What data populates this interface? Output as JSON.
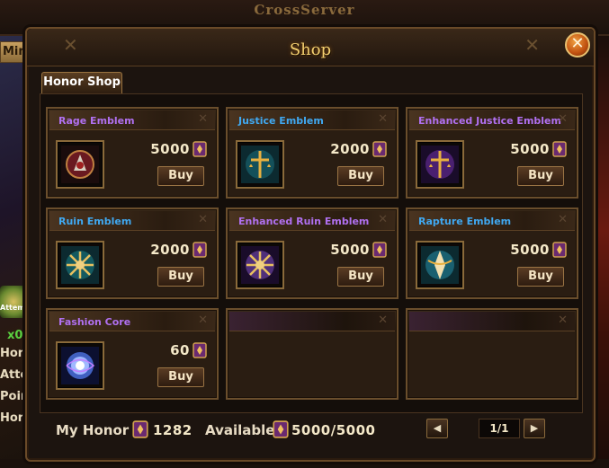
{
  "background": {
    "top_title": "CrossServer",
    "left_tab": "Mine",
    "left_counter": "x0",
    "left_words": [
      "Hon",
      "Atte",
      "Poin",
      "Hon"
    ],
    "left_badge_text": "Attemp"
  },
  "window": {
    "title": "Shop",
    "close_label": "✕"
  },
  "tab": {
    "label": "Honor Shop"
  },
  "items": [
    {
      "name": "Rage Emblem",
      "name_color": "#b070f0",
      "price": "5000",
      "buy_label": "Buy",
      "icon": "rage-emblem-icon"
    },
    {
      "name": "Justice Emblem",
      "name_color": "#40a8f0",
      "price": "2000",
      "buy_label": "Buy",
      "icon": "justice-emblem-icon"
    },
    {
      "name": "Enhanced Justice Emblem",
      "name_color": "#b070f0",
      "price": "5000",
      "buy_label": "Buy",
      "icon": "enhanced-justice-emblem-icon"
    },
    {
      "name": "Ruin Emblem",
      "name_color": "#40a8f0",
      "price": "2000",
      "buy_label": "Buy",
      "icon": "ruin-emblem-icon"
    },
    {
      "name": "Enhanced Ruin Emblem",
      "name_color": "#b070f0",
      "price": "5000",
      "buy_label": "Buy",
      "icon": "enhanced-ruin-emblem-icon"
    },
    {
      "name": "Rapture Emblem",
      "name_color": "#40a8f0",
      "price": "5000",
      "buy_label": "Buy",
      "icon": "rapture-emblem-icon"
    },
    {
      "name": "Fashion Core",
      "name_color": "#b070f0",
      "price": "60",
      "buy_label": "Buy",
      "icon": "fashion-core-icon"
    }
  ],
  "footer": {
    "my_honor_label": "My Honor",
    "my_honor_value": "1282",
    "available_label": "Available",
    "available_value": "5000/5000",
    "page": "1/1",
    "prev_icon": "triangle-left-icon",
    "next_icon": "triangle-right-icon"
  },
  "colors": {
    "accent_gold": "#f4d070",
    "frame_brown": "#6a4e2c",
    "epic_purple": "#b070f0",
    "rare_blue": "#40a8f0"
  }
}
